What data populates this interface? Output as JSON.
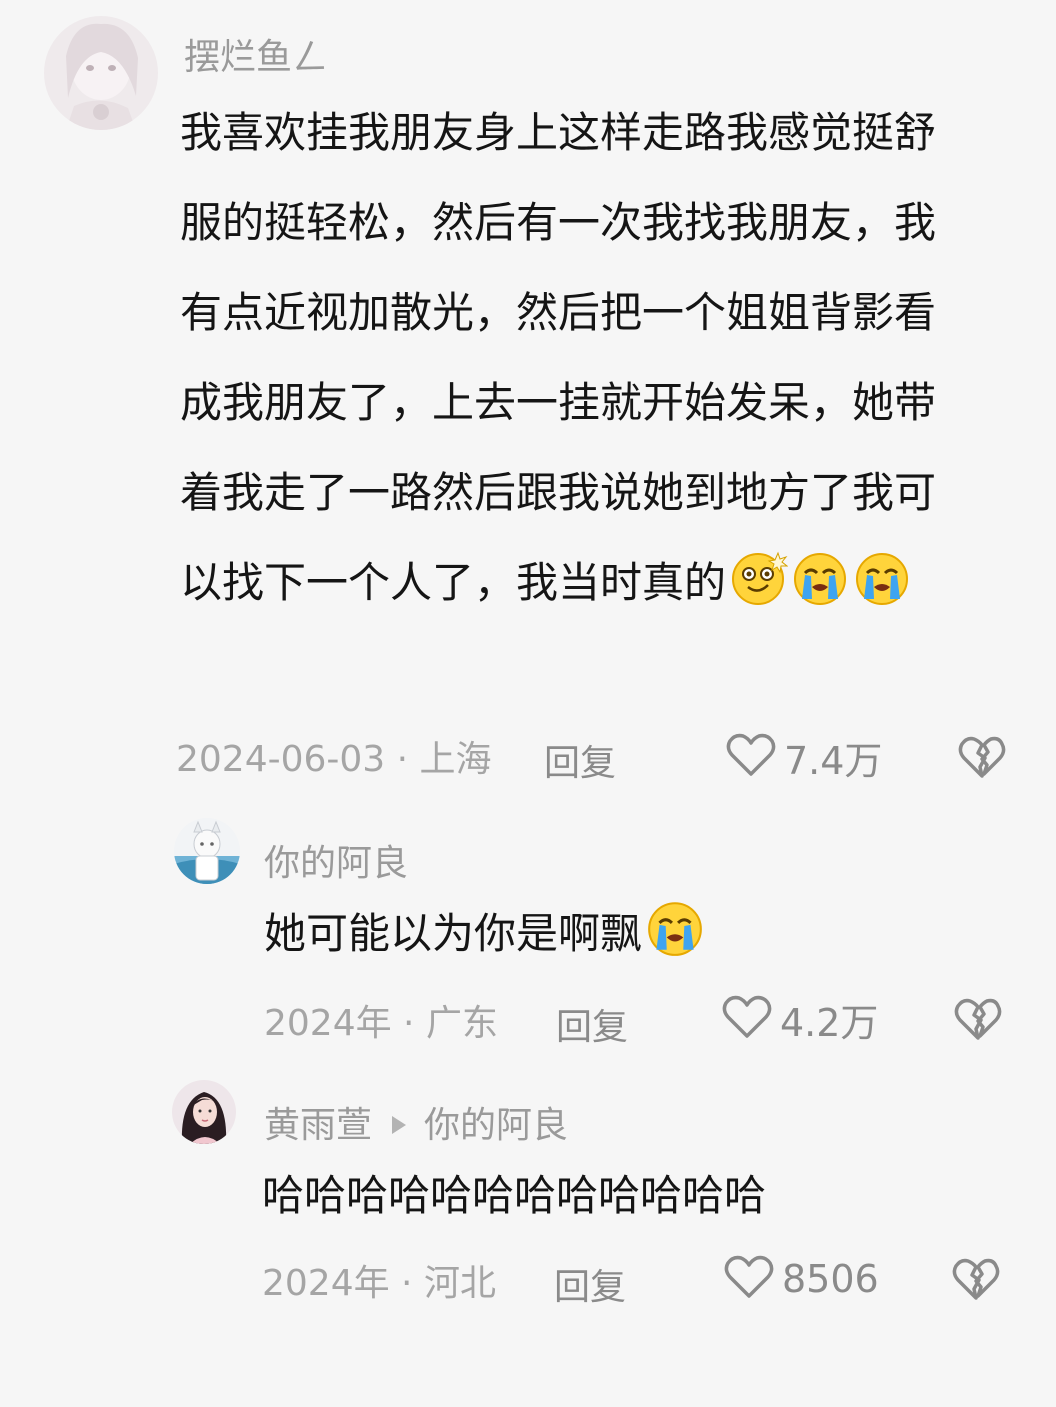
{
  "comments": [
    {
      "username": "摆烂鱼ㄥ",
      "lines": [
        "我喜欢挂我朋友身上这样走路我感觉挺舒",
        "服的挺轻松，然后有一次我找我朋友，我",
        "有点近视加散光，然后把一个姐姐背影看",
        "成我朋友了，上去一挂就开始发呆，她带",
        "着我走了一路然后跟我说她到地方了我可",
        "以找下一个人了，我当时真的"
      ],
      "emojis": [
        "dizzy-face",
        "crying-face",
        "crying-face"
      ],
      "meta": "2024-06-03 · 上海",
      "reply_label": "回复",
      "likes": "7.4万"
    },
    {
      "username": "你的阿良",
      "text": "她可能以为你是啊飘",
      "emojis": [
        "crying-face"
      ],
      "meta": "2024年 · 广东",
      "reply_label": "回复",
      "likes": "4.2万"
    },
    {
      "username": "黄雨萱",
      "reply_to": "你的阿良",
      "text": "哈哈哈哈哈哈哈哈哈哈哈哈",
      "meta": "2024年 · 河北",
      "reply_label": "回复",
      "likes": "8506"
    }
  ],
  "colors": {
    "background": "#f6f6f6",
    "username": "#9a9a9a",
    "content": "#151515",
    "meta": "#a5a5a5",
    "action": "#8a8a8a"
  },
  "icons": [
    "heart-outline-icon",
    "broken-heart-icon",
    "play-arrow-icon"
  ]
}
